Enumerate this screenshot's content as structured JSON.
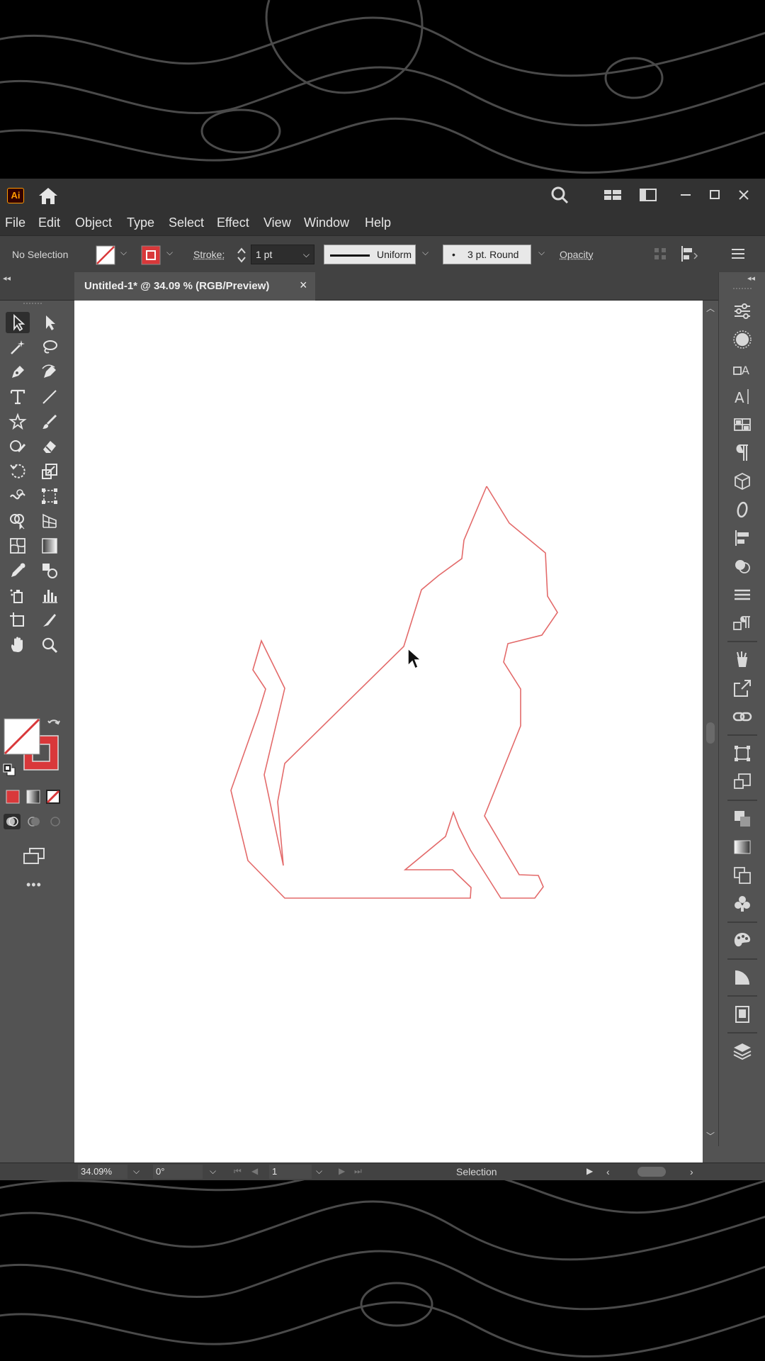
{
  "app": {
    "logo": "Ai",
    "home_icon": "home-icon"
  },
  "menu": [
    "File",
    "Edit",
    "Object",
    "Type",
    "Select",
    "Effect",
    "View",
    "Window",
    "Help"
  ],
  "control_bar": {
    "selection_status": "No Selection",
    "stroke_label": "Stroke:",
    "stroke_weight": "1 pt",
    "profile_label": "Uniform",
    "brush_label": "3 pt. Round",
    "opacity_label": "Opacity"
  },
  "document_tab": {
    "title": "Untitled-1* @ 34.09 % (RGB/Preview)",
    "close": "×"
  },
  "status_bar": {
    "zoom": "34.09%",
    "rotation": "0°",
    "artboard_number": "1",
    "current_tool": "Selection"
  },
  "colors": {
    "stroke": "#d9383a",
    "accent_path": "#e36a6a",
    "ui_dark": "#323232",
    "ui_mid": "#535353"
  },
  "icons": [
    "search-icon",
    "workspace-switcher-icon",
    "arrange-documents-icon",
    "minimize-icon",
    "maximize-icon",
    "close-icon"
  ]
}
